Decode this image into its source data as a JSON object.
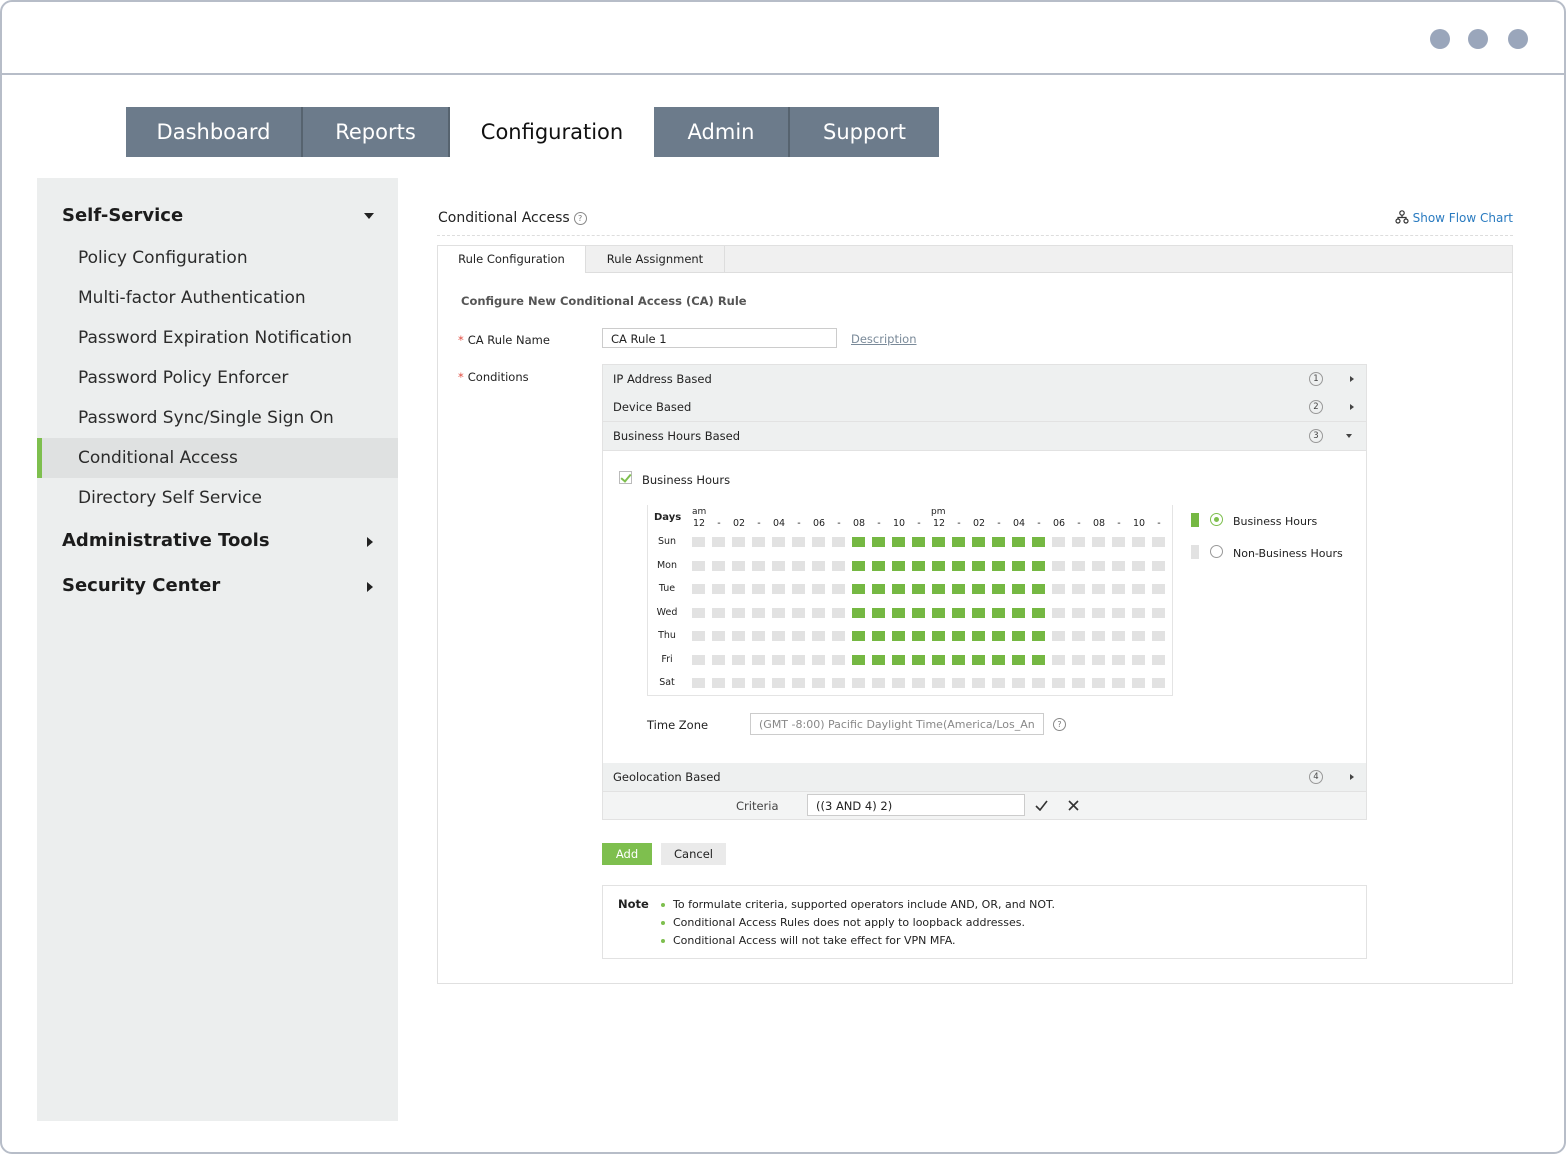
{
  "nav": {
    "tabs": [
      {
        "label": "Dashboard",
        "active": false
      },
      {
        "label": "Reports",
        "active": false
      },
      {
        "label": "Configuration",
        "active": true
      },
      {
        "label": "Admin",
        "active": false
      },
      {
        "label": "Support",
        "active": false
      }
    ]
  },
  "sidebar": {
    "self_service": "Self-Service",
    "items": [
      "Policy Configuration",
      "Multi-factor Authentication",
      "Password Expiration Notification",
      "Password Policy Enforcer",
      "Password Sync/Single Sign On",
      "Conditional Access",
      "Directory Self Service"
    ],
    "active_item": "Conditional Access",
    "admin_tools": "Administrative Tools",
    "security_center": "Security Center"
  },
  "page": {
    "title": "Conditional Access",
    "flow_chart": "Show Flow Chart",
    "subtabs": [
      "Rule Configuration",
      "Rule Assignment"
    ],
    "heading": "Configure New Conditional Access (CA) Rule"
  },
  "form": {
    "rule_name_label": "CA Rule Name",
    "rule_name_value": "CA Rule 1",
    "description_link": "Description",
    "conditions_label": "Conditions",
    "conditions": [
      {
        "label": "IP Address Based",
        "num": "1",
        "expanded": false
      },
      {
        "label": "Device Based",
        "num": "2",
        "expanded": false
      },
      {
        "label": "Business Hours Based",
        "num": "3",
        "expanded": true
      },
      {
        "label": "Geolocation Based",
        "num": "4",
        "expanded": false
      }
    ],
    "business_hours_checkbox": "Business Hours",
    "days_header": "Days",
    "am_label": "am",
    "pm_label": "pm",
    "hour_labels": [
      "12",
      "-",
      "02",
      "-",
      "04",
      "-",
      "06",
      "-",
      "08",
      "-",
      "10",
      "-",
      "12",
      "-",
      "02",
      "-",
      "04",
      "-",
      "06",
      "-",
      "08",
      "-",
      "10",
      "-"
    ],
    "days": [
      "Sun",
      "Mon",
      "Tue",
      "Wed",
      "Thu",
      "Fri",
      "Sat"
    ],
    "active_days": [
      "Sun",
      "Mon",
      "Tue",
      "Wed",
      "Thu",
      "Fri"
    ],
    "business_start_hour": 8,
    "business_end_hour": 18,
    "legend_business": "Business Hours",
    "legend_non_business": "Non-Business Hours",
    "time_zone_label": "Time Zone",
    "time_zone_value": "(GMT -8:00) Pacific Daylight Time(America/Los_An",
    "criteria_label": "Criteria",
    "criteria_value": "((3 AND 4) 2)",
    "add_button": "Add",
    "cancel_button": "Cancel"
  },
  "note": {
    "title": "Note",
    "items": [
      "To formulate criteria, supported operators include AND, OR, and NOT.",
      "Conditional Access Rules does not apply to loopback addresses.",
      "Conditional Access will not take effect for VPN MFA."
    ]
  },
  "colors": {
    "nav_bg": "#6c7b8b",
    "accent_green": "#7ebf4e",
    "link_blue": "#2a7bc0",
    "cell_off": "#e2e2e2"
  }
}
